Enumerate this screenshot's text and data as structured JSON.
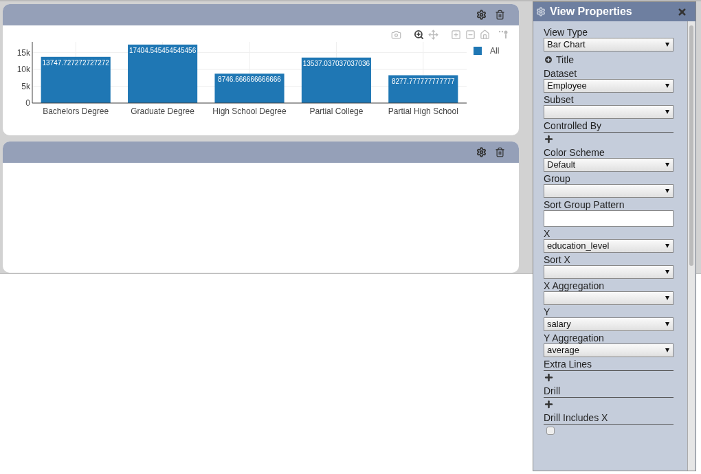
{
  "panels": [
    {
      "kind": "chart",
      "chart_data": {
        "type": "bar",
        "categories": [
          "Bachelors Degree",
          "Graduate Degree",
          "High School Degree",
          "Partial College",
          "Partial High School"
        ],
        "series": [
          {
            "name": "All",
            "color": "#1f77b4",
            "values": [
              13747.727272727272,
              17404.545454545456,
              8746.666666666666,
              13537.037037037036,
              8277.777777777777
            ]
          }
        ],
        "ylim": [
          0,
          18200
        ],
        "yticks": [
          {
            "value": 0,
            "label": "0"
          },
          {
            "value": 5000,
            "label": "5k"
          },
          {
            "value": 10000,
            "label": "10k"
          },
          {
            "value": 15000,
            "label": "15k"
          }
        ],
        "data_labels": true,
        "grid": true
      }
    },
    {
      "kind": "empty"
    }
  ],
  "properties": {
    "title": "View Properties",
    "fields": [
      {
        "kind": "select",
        "label": "View Type",
        "value": "Bar Chart"
      },
      {
        "kind": "title_button",
        "label": "Title"
      },
      {
        "kind": "select",
        "label": "Dataset",
        "value": "Employee"
      },
      {
        "kind": "select",
        "label": "Subset"
      },
      {
        "kind": "adder",
        "label": "Controlled By"
      },
      {
        "kind": "select",
        "label": "Color Scheme",
        "value": "Default"
      },
      {
        "kind": "select",
        "label": "Group"
      },
      {
        "kind": "text",
        "label": "Sort Group Pattern"
      },
      {
        "kind": "select",
        "label": "X",
        "value": "education_level"
      },
      {
        "kind": "select",
        "label": "Sort X"
      },
      {
        "kind": "select",
        "label": "X Aggregation"
      },
      {
        "kind": "select",
        "label": "Y",
        "value": "salary"
      },
      {
        "kind": "select",
        "label": "Y Aggregation",
        "value": "average"
      },
      {
        "kind": "adder",
        "label": "Extra Lines"
      },
      {
        "kind": "adder",
        "label": "Drill"
      },
      {
        "kind": "checkbox",
        "label": "Drill Includes X",
        "checked": false
      }
    ]
  }
}
